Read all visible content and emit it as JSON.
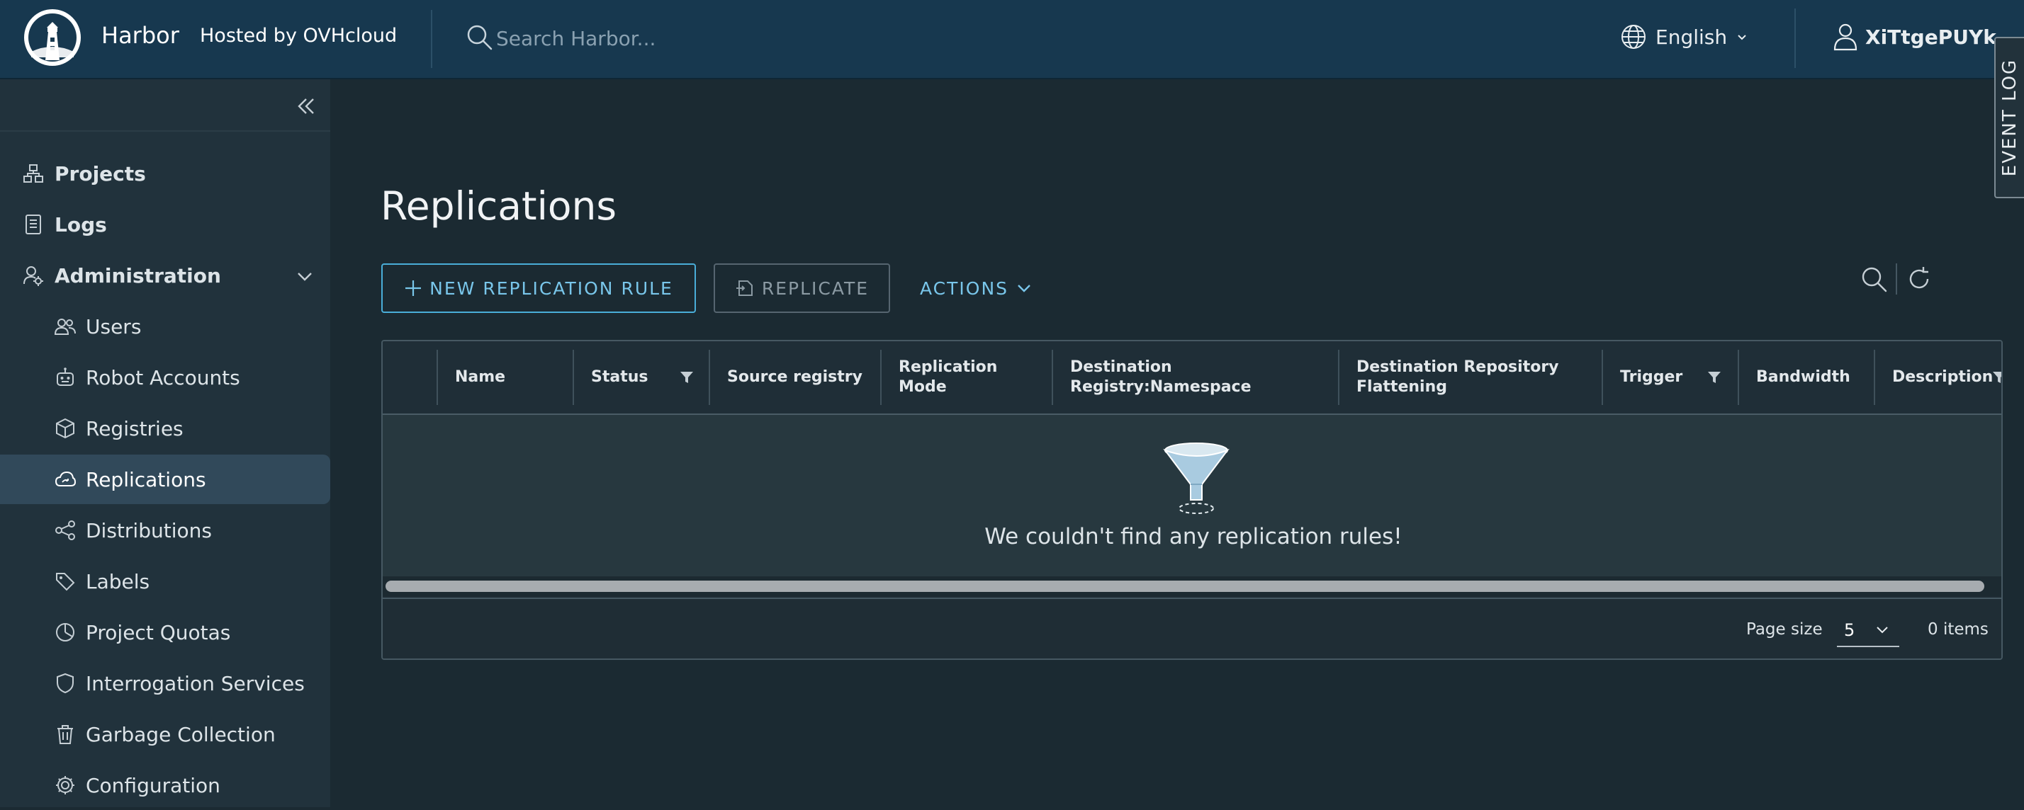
{
  "header": {
    "app_name": "Harbor",
    "hosted_by": "Hosted by OVHcloud",
    "search_placeholder": "Search Harbor...",
    "language": "English",
    "username": "XiTtgePUYk",
    "event_log": "EVENT LOG"
  },
  "sidebar": {
    "items": [
      {
        "label": "Projects",
        "icon": "projects-icon"
      },
      {
        "label": "Logs",
        "icon": "logs-icon"
      },
      {
        "label": "Administration",
        "icon": "administration-icon",
        "expanded": true
      },
      {
        "label": "Users",
        "icon": "users-icon"
      },
      {
        "label": "Robot Accounts",
        "icon": "robot-icon"
      },
      {
        "label": "Registries",
        "icon": "registries-icon"
      },
      {
        "label": "Replications",
        "icon": "replications-icon",
        "active": true
      },
      {
        "label": "Distributions",
        "icon": "distributions-icon"
      },
      {
        "label": "Labels",
        "icon": "labels-icon"
      },
      {
        "label": "Project Quotas",
        "icon": "quotas-icon"
      },
      {
        "label": "Interrogation Services",
        "icon": "shield-icon"
      },
      {
        "label": "Garbage Collection",
        "icon": "trash-icon"
      },
      {
        "label": "Configuration",
        "icon": "gear-icon"
      }
    ]
  },
  "main": {
    "title": "Replications",
    "new_rule_label": "NEW REPLICATION RULE",
    "replicate_label": "REPLICATE",
    "actions_label": "ACTIONS",
    "table": {
      "columns": [
        {
          "label": "Name"
        },
        {
          "label": "Status",
          "filter": true
        },
        {
          "label": "Source registry"
        },
        {
          "label": "Replication Mode"
        },
        {
          "label": "Destination Registry:Namespace"
        },
        {
          "label": "Destination Repository Flattening"
        },
        {
          "label": "Trigger",
          "filter": true
        },
        {
          "label": "Bandwidth"
        },
        {
          "label": "Description",
          "filter": true
        }
      ],
      "empty_message": "We couldn't find any replication rules!",
      "page_size_label": "Page size",
      "page_size": "5",
      "items_count": "0 items"
    }
  },
  "colors": {
    "header_bg": "#17384f",
    "sidebar_bg": "#21323c",
    "main_bg": "#1b2a32",
    "accent": "#4aaed9",
    "active_item_bg": "#31495a"
  }
}
